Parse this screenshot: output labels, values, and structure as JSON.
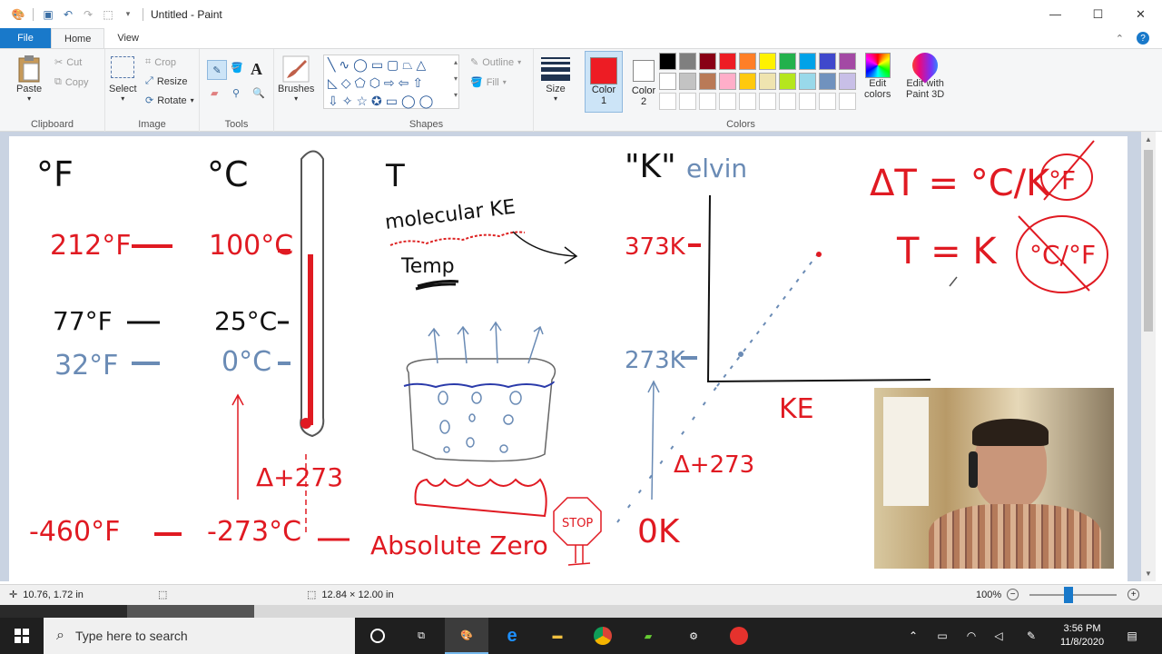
{
  "titlebar": {
    "title": "Untitled - Paint",
    "minimize": "—",
    "maximize": "☐",
    "close": "✕"
  },
  "tabs": {
    "file": "File",
    "home": "Home",
    "view": "View"
  },
  "ribbon": {
    "clipboard": {
      "label": "Clipboard",
      "paste": "Paste",
      "cut": "Cut",
      "copy": "Copy"
    },
    "image": {
      "label": "Image",
      "select": "Select",
      "crop": "Crop",
      "resize": "Resize",
      "rotate": "Rotate"
    },
    "tools": {
      "label": "Tools"
    },
    "brushes": {
      "label": "Brushes"
    },
    "shapes": {
      "label": "Shapes",
      "outline": "Outline",
      "fill": "Fill"
    },
    "size": {
      "label": "Size"
    },
    "colors": {
      "label": "Colors",
      "color1": "Color",
      "color1_num": "1",
      "color2": "Color",
      "color2_num": "2",
      "edit_colors_1": "Edit",
      "edit_colors_2": "colors",
      "paint3d_1": "Edit with",
      "paint3d_2": "Paint 3D",
      "color1_value": "#ed1c24",
      "color2_value": "#ffffff",
      "palette_row1": [
        "#000000",
        "#7f7f7f",
        "#880015",
        "#ed1c24",
        "#ff7f27",
        "#fff200",
        "#22b14c",
        "#00a2e8",
        "#3f48cc",
        "#a349a4"
      ],
      "palette_row2": [
        "#ffffff",
        "#c3c3c3",
        "#b97a57",
        "#ffaec9",
        "#ffc90e",
        "#efe4b0",
        "#b5e61d",
        "#99d9ea",
        "#7092be",
        "#c8bfe7"
      ]
    }
  },
  "drawing": {
    "deg_f": "°F",
    "deg_c": "°C",
    "t": "T",
    "molecular_ke": "molecular KE",
    "temp": "Temp",
    "kelvin_k": "\"K\"",
    "kelvin_rest": "elvin",
    "delta_eq": "ΔT = °C/K",
    "circled_f": "°F",
    "t_eq_k": "T = K",
    "circled_cf": "°C/°F",
    "f212": "212°F",
    "c100": "100°C",
    "k373": "373K",
    "f77": "77°F",
    "c25": "25°C",
    "f32": "32°F",
    "c0": "0°C",
    "k273": "273K",
    "ke": "KE",
    "delta273_left": "Δ+273",
    "delta273_right": "Δ+273",
    "f_neg460": "-460°F",
    "c_neg273": "-273°C",
    "absolute_zero": "Absolute Zero",
    "stop": "STOP",
    "zero_k": "0K"
  },
  "status": {
    "cursor_pos": "10.76, 1.72 in",
    "canvas_size": "12.84 × 12.00 in",
    "zoom": "100%"
  },
  "taskbar": {
    "search_placeholder": "Type here to search",
    "time": "3:56 PM",
    "date": "11/8/2020"
  }
}
